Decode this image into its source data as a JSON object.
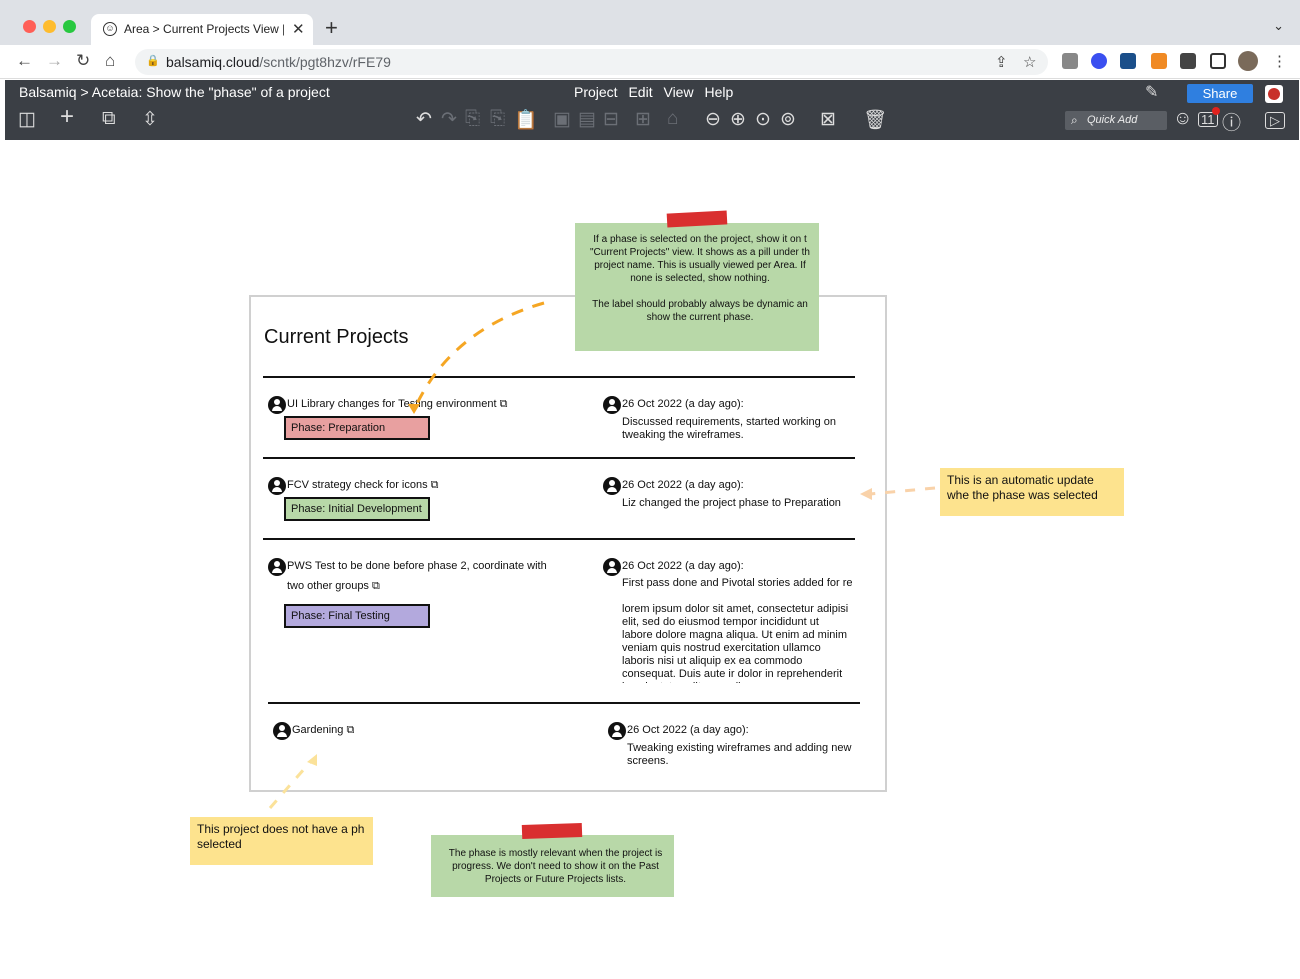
{
  "browser": {
    "tab_title": "Area > Current Projects View | B",
    "tab_close": "✕",
    "new_tab": "+",
    "url_host": "balsamiq.cloud",
    "url_path": "/scntk/pgt8hzv/rFE79"
  },
  "app": {
    "breadcrumb": "Balsamiq > Acetaia: Show the \"phase\" of a project",
    "menu": [
      "Project",
      "Edit",
      "View",
      "Help"
    ],
    "share_label": "Share",
    "quick_add_placeholder": "Quick Add",
    "comment_count": "11"
  },
  "mockup": {
    "heading": "Current Projects",
    "projects": [
      {
        "title": "UI Library changes for Testing environment",
        "phase": "Phase: Preparation",
        "phase_color": "#e8a0a0",
        "update_date": "26 Oct 2022 (a day ago):",
        "update_text": "Discussed requirements, started working on tweaking the wireframes."
      },
      {
        "title": "FCV strategy check for icons",
        "phase": "Phase: Initial Development",
        "phase_color": "#b8d8a8",
        "update_date": "26 Oct 2022 (a day ago):",
        "update_text": "Liz changed the project phase to Preparation"
      },
      {
        "title_line1": "PWS Test to be done before phase 2, coordinate with",
        "title_line2": "two other groups",
        "phase": "Phase: Final Testing",
        "phase_color": "#b3a9dd",
        "update_date": "26 Oct 2022 (a day ago):",
        "update_text": "First pass done and Pivotal stories added for re",
        "update_text2": "lorem ipsum dolor sit amet, consectetur adipisi elit, sed do eiusmod tempor incididunt ut labore dolore magna aliqua. Ut enim ad minim veniam quis nostrud exercitation ullamco laboris nisi ut aliquip ex ea commodo consequat. Duis aute ir dolor in reprehenderit in voluptate velit esse cil"
      },
      {
        "title": "Gardening",
        "update_date": "26 Oct 2022 (a day ago):",
        "update_text": "Tweaking existing wireframes and adding new screens."
      }
    ]
  },
  "notes": {
    "top_green": "If a phase is selected on the project, show it on t\n\"Current Projects\" view. It shows as a pill under th\nproject name. This is usually viewed per Area. If\nnone is selected, show nothing.\n\nThe label should probably always be dynamic an\nshow the current phase.",
    "right_yellow": "This is an automatic update whe the phase was selected",
    "bottom_left_yellow": "This project does not have a ph selected",
    "bottom_green": "The phase is mostly relevant when the project is\nprogress. We don't need to show it on the Past\nProjects or Future Projects lists."
  },
  "icons": {
    "ext_link": "external-link-icon",
    "avatar": "user-avatar-icon"
  }
}
